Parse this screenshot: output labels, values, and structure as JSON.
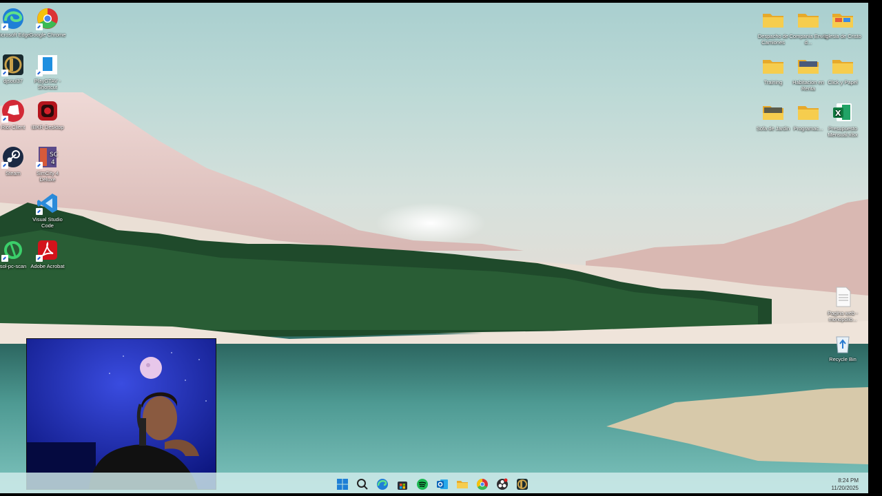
{
  "desktop": {
    "left_icons": [
      {
        "label": "Microsoft Edge",
        "icon": "edge-icon"
      },
      {
        "label": "Google Chrome",
        "icon": "chrome-icon"
      },
      {
        "label": "djsoul37",
        "icon": "league-icon"
      },
      {
        "label": "PlayGTAV - Shortcut",
        "icon": "gtav-icon"
      },
      {
        "label": "Riot Client",
        "icon": "riot-icon"
      },
      {
        "label": "IBKR Desktop",
        "icon": "ibkr-icon"
      },
      {
        "label": "Steam",
        "icon": "steam-icon"
      },
      {
        "label": "SimCity 4 Deluxe",
        "icon": "simcity-icon"
      },
      {
        "label": "Visual Studio Code",
        "icon": "vscode-icon"
      },
      {
        "label": "sol-pc-scan",
        "icon": "scan-icon"
      },
      {
        "label": "Adobe Acrobat",
        "icon": "acrobat-icon"
      }
    ],
    "right_icons": [
      {
        "label": "Despacho de Camiones",
        "icon": "folder-icon"
      },
      {
        "label": "Compania Envio d...",
        "icon": "folder-icon"
      },
      {
        "label": "Iglesia de Cristo",
        "icon": "folder-icon"
      },
      {
        "label": "Training",
        "icon": "folder-icon"
      },
      {
        "label": "Habitacion en Renta",
        "icon": "folder-image-icon"
      },
      {
        "label": "Click y Papel",
        "icon": "folder-icon"
      },
      {
        "label": "Sofa de Jardin",
        "icon": "folder-image-icon"
      },
      {
        "label": "Programac...",
        "icon": "folder-icon"
      },
      {
        "label": "Presupuesto Mensual.xlsx",
        "icon": "excel-icon"
      },
      {
        "label": "Pagina web - monopolio...",
        "icon": "document-icon"
      },
      {
        "label": "Recycle Bin",
        "icon": "recycle-bin-icon"
      }
    ]
  },
  "taskbar": {
    "apps": [
      "start-icon",
      "search-icon",
      "edge-icon",
      "store-icon",
      "spotify-icon",
      "outlook-icon",
      "file-explorer-icon",
      "chrome-icon",
      "obs-icon",
      "league-icon"
    ],
    "clock_time": "8:24 PM",
    "clock_date": "11/20/2025"
  },
  "colors": {
    "folder": "#f4c53d",
    "taskbar": "#d2ecec",
    "windows_blue": "#1e7fd6"
  }
}
